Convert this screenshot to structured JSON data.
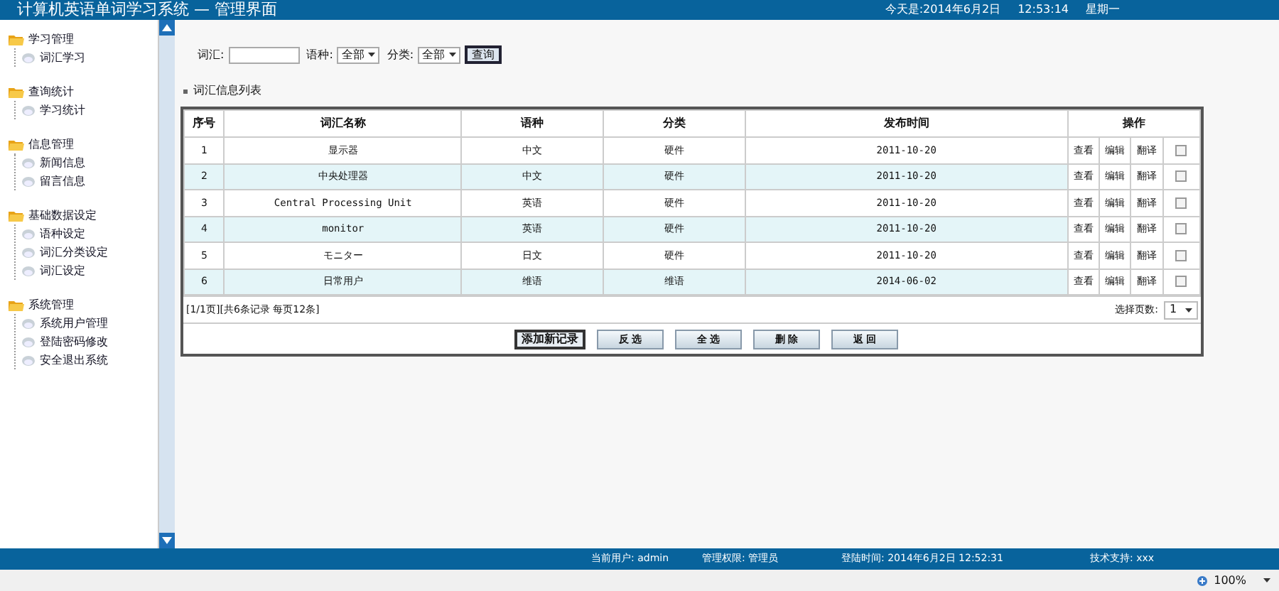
{
  "header": {
    "title": "计算机英语单词学习系统 — 管理界面",
    "date_text": "今天是:2014年6月2日",
    "time": "12:53:14",
    "weekday": "星期一"
  },
  "sidebar": {
    "groups": [
      {
        "label": "学习管理",
        "children": [
          {
            "label": "词汇学习"
          }
        ]
      },
      {
        "label": "查询统计",
        "children": [
          {
            "label": "学习统计"
          }
        ]
      },
      {
        "label": "信息管理",
        "children": [
          {
            "label": "新闻信息"
          },
          {
            "label": "留言信息"
          }
        ]
      },
      {
        "label": "基础数据设定",
        "children": [
          {
            "label": "语种设定"
          },
          {
            "label": "词汇分类设定"
          },
          {
            "label": "词汇设定"
          }
        ]
      },
      {
        "label": "系统管理",
        "children": [
          {
            "label": "系统用户管理"
          },
          {
            "label": "登陆密码修改"
          },
          {
            "label": "安全退出系统"
          }
        ]
      }
    ]
  },
  "search": {
    "word_label": "词汇:",
    "language_label": "语种:",
    "language_value": "全部",
    "category_label": "分类:",
    "category_value": "全部",
    "button": "查询"
  },
  "section_title": "词汇信息列表",
  "table": {
    "columns": [
      "序号",
      "词汇名称",
      "语种",
      "分类",
      "发布时间",
      "操作"
    ],
    "rows": [
      {
        "cells": [
          "1",
          "显示器",
          "中文",
          "硬件",
          "2011-10-20"
        ],
        "actions": [
          "查看",
          "编辑",
          "翻译"
        ],
        "checked": false
      },
      {
        "cells": [
          "2",
          "中央处理器",
          "中文",
          "硬件",
          "2011-10-20"
        ],
        "actions": [
          "查看",
          "编辑",
          "翻译"
        ],
        "checked": false
      },
      {
        "cells": [
          "3",
          "Central Processing Unit",
          "英语",
          "硬件",
          "2011-10-20"
        ],
        "actions": [
          "查看",
          "编辑",
          "翻译"
        ],
        "checked": false
      },
      {
        "cells": [
          "4",
          "monitor",
          "英语",
          "硬件",
          "2011-10-20"
        ],
        "actions": [
          "查看",
          "编辑",
          "翻译"
        ],
        "checked": false
      },
      {
        "cells": [
          "5",
          "モニター",
          "日文",
          "硬件",
          "2011-10-20"
        ],
        "actions": [
          "查看",
          "编辑",
          "翻译"
        ],
        "checked": false
      },
      {
        "cells": [
          "6",
          "日常用户",
          "维语",
          "维语",
          "2014-06-02"
        ],
        "actions": [
          "查看",
          "编辑",
          "翻译"
        ],
        "checked": false
      }
    ]
  },
  "pagination": {
    "info": "[1/1页][共6条记录 每页12条]",
    "page_label": "选择页数:",
    "page_value": "1"
  },
  "buttons": [
    "添加新记录",
    "反 选",
    "全 选",
    "删 除",
    "返 回"
  ],
  "status_bar": {
    "user": "当前用户: admin",
    "role": "管理权限: 管理员",
    "login_time": "登陆时间: 2014年6月2日 12:52:31",
    "support": "技术支持: xxx"
  },
  "browser_bar": {
    "zoom": "100%"
  }
}
